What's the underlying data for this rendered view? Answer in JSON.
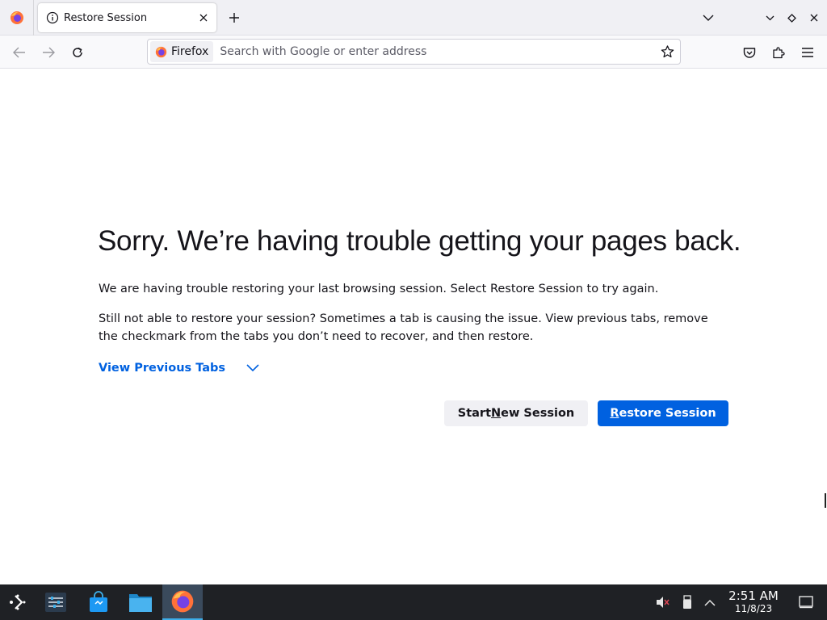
{
  "browser": {
    "tab": {
      "title": "Restore Session"
    },
    "urlbar": {
      "identity_label": "Firefox",
      "placeholder": "Search with Google or enter address"
    }
  },
  "page": {
    "heading": "Sorry. We’re having trouble getting your pages back.",
    "message": "We are having trouble restoring your last browsing session. Select Restore Session to try again.",
    "help": "Still not able to restore your session? Sometimes a tab is causing the issue. View previous tabs, remove the checkmark from the tabs you don’t need to recover, and then restore.",
    "view_tabs_label": "View Previous Tabs",
    "start_new_session": {
      "before": "Start ",
      "accesskey": "N",
      "after": "ew Session"
    },
    "restore_session": {
      "before": "",
      "accesskey": "R",
      "after": "estore Session"
    }
  },
  "taskbar": {
    "time": "2:51 AM",
    "date": "11/8/23",
    "icons": [
      "app-launcher-icon",
      "system-settings-icon",
      "discover-store-icon",
      "file-manager-icon",
      "firefox-icon"
    ],
    "tray_icons": [
      "volume-muted-icon",
      "removable-device-icon",
      "tray-expand-icon",
      "show-desktop-icon"
    ]
  },
  "colors": {
    "accent": "#0061e0",
    "taskbar": "#1f2125",
    "tabstrip": "#f0f0f4"
  }
}
